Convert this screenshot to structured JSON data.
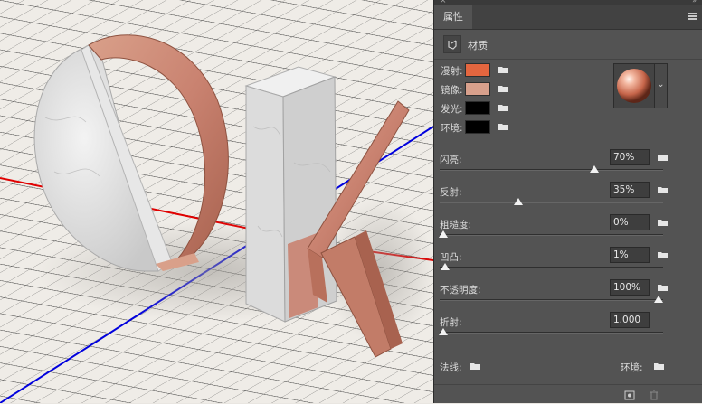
{
  "panel": {
    "tab_label": "属性",
    "section_title": "材质",
    "icons": {
      "close": "close-x-icon",
      "collapse": "double-chevron-icon",
      "menu": "hamburger-menu-icon",
      "material": "material-cube-icon",
      "folder": "folder-icon",
      "preview": "material-sphere-preview",
      "dropdown": "chevron-down-icon",
      "new_material": "new-material-icon",
      "trash": "trash-icon"
    },
    "swatches": [
      {
        "label": "漫射:",
        "color": "#e4663f"
      },
      {
        "label": "镜像:",
        "color": "#d8a08c"
      },
      {
        "label": "发光:",
        "color": "#000000"
      },
      {
        "label": "环境:",
        "color": "#000000"
      }
    ],
    "sliders": [
      {
        "label": "闪亮:",
        "value": "70%",
        "fraction": 0.7,
        "has_folder": true
      },
      {
        "label": "反射:",
        "value": "35%",
        "fraction": 0.35,
        "has_folder": true
      },
      {
        "label": "粗糙度:",
        "value": "0%",
        "fraction": 0.0,
        "has_folder": true
      },
      {
        "label": "凹凸:",
        "value": "1%",
        "fraction": 0.01,
        "has_folder": true
      },
      {
        "label": "不透明度:",
        "value": "100%",
        "fraction": 1.0,
        "has_folder": true
      },
      {
        "label": "折射:",
        "value": "1.000",
        "fraction": 0.0,
        "has_folder": false
      }
    ],
    "normal_label": "法线:",
    "environment_label": "环境:"
  },
  "colors": {
    "copper": "#c98a73",
    "copper_dark": "#a8654f",
    "marble": "#d9d9d9",
    "axis_red": "#e00000",
    "axis_blue": "#0000dd",
    "panel_bg": "#535353"
  }
}
